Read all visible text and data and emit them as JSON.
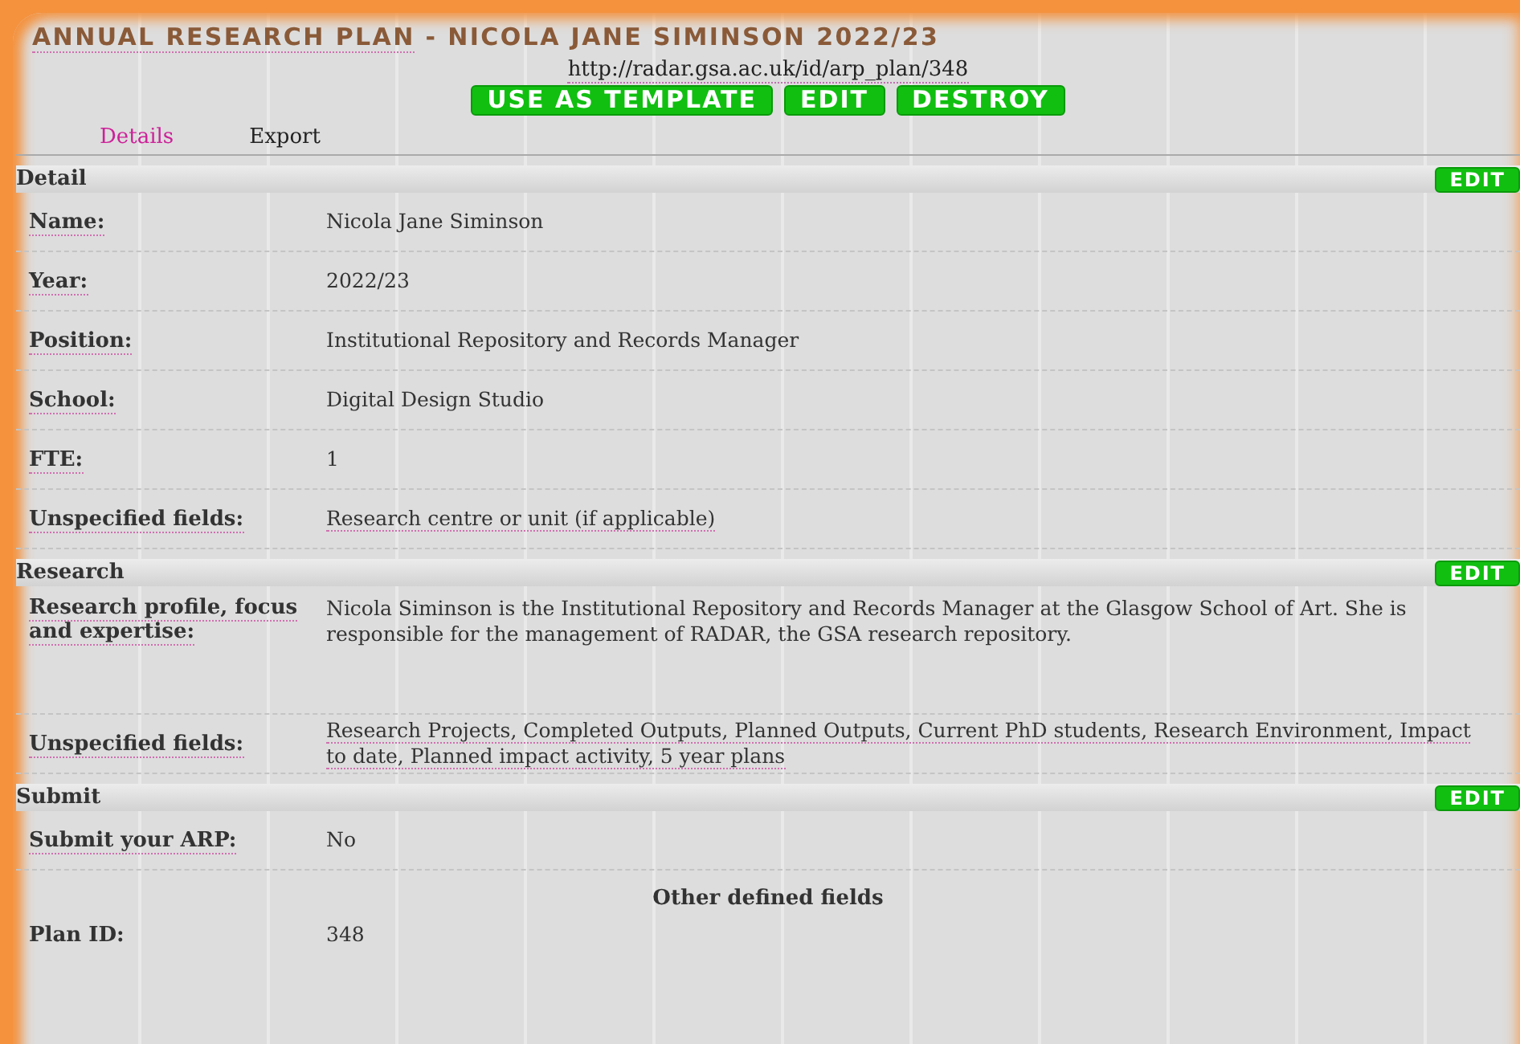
{
  "title": {
    "link": "ANNUAL RESEARCH PLAN",
    "rest": " - NICOLA JANE SIMINSON 2022/23"
  },
  "url": "http://radar.gsa.ac.uk/id/arp_plan/348",
  "actions": [
    "USE AS TEMPLATE",
    "EDIT",
    "DESTROY"
  ],
  "tabs": [
    {
      "label": "Details",
      "selected": true
    },
    {
      "label": "Export",
      "selected": false
    }
  ],
  "sections": [
    {
      "title": "Detail",
      "edit": "EDIT",
      "rows": [
        {
          "label": "Name:",
          "value": "Nicola Jane Siminson",
          "linked": false
        },
        {
          "label": "Year:",
          "value": "2022/23",
          "linked": false
        },
        {
          "label": "Position:",
          "value": "Institutional Repository and Records Manager",
          "linked": false
        },
        {
          "label": "School:",
          "value": "Digital Design Studio",
          "linked": false
        },
        {
          "label": "FTE:",
          "value": "1",
          "linked": false
        },
        {
          "label": "Unspecified fields:",
          "value": "Research centre or unit (if applicable)",
          "linked": true
        }
      ]
    },
    {
      "title": "Research",
      "edit": "EDIT",
      "rows": [
        {
          "label": "Research profile, focus and expertise:",
          "value": "Nicola Siminson is the Institutional Repository and Records Manager at the Glasgow School of Art. She is responsible for the management of RADAR, the GSA research repository.",
          "linked": false,
          "tall": true
        },
        {
          "label": "Unspecified fields:",
          "value": "Research Projects, Completed Outputs, Planned Outputs, Current PhD students, Research Environment, Impact to date, Planned impact activity, 5 year plans",
          "linked": true
        }
      ]
    },
    {
      "title": "Submit",
      "edit": "EDIT",
      "rows": [
        {
          "label": "Submit your ARP:",
          "value": "No",
          "linked": false
        }
      ]
    }
  ],
  "other": {
    "title": "Other defined fields",
    "rows": [
      {
        "label": "Plan ID:",
        "value": "348"
      }
    ]
  }
}
